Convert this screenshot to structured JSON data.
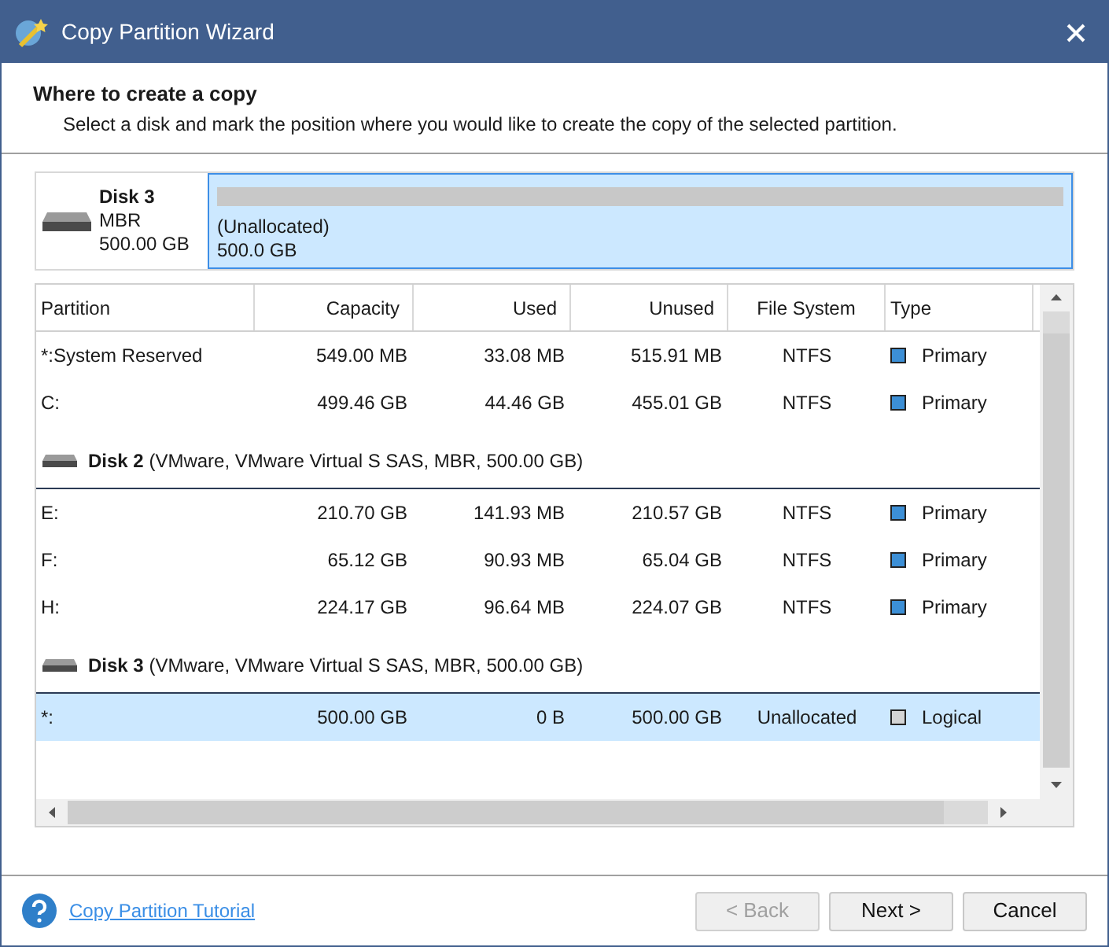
{
  "window": {
    "title": "Copy Partition Wizard"
  },
  "header": {
    "title": "Where to create a copy",
    "subtitle": "Select a disk and mark the position where you would like to create the copy of the selected partition."
  },
  "disk_map": {
    "name": "Disk 3",
    "scheme": "MBR",
    "size": "500.00 GB",
    "segments": [
      {
        "label": "(Unallocated)",
        "size": "500.0 GB",
        "selected": true
      }
    ]
  },
  "table": {
    "columns": [
      "Partition",
      "Capacity",
      "Used",
      "Unused",
      "File System",
      "Type"
    ],
    "rows": [
      {
        "kind": "partition",
        "selected": false,
        "cells": [
          "*:System Reserved",
          "549.00 MB",
          "33.08 MB",
          "515.91 MB",
          "NTFS",
          "Primary"
        ],
        "color": "#3c8fd6"
      },
      {
        "kind": "partition",
        "selected": false,
        "cells": [
          "C:",
          "499.46 GB",
          "44.46 GB",
          "455.01 GB",
          "NTFS",
          "Primary"
        ],
        "color": "#3c8fd6"
      },
      {
        "kind": "disk",
        "name": "Disk 2",
        "details": "(VMware, VMware Virtual S SAS, MBR, 500.00 GB)"
      },
      {
        "kind": "partition",
        "selected": false,
        "cells": [
          "E:",
          "210.70 GB",
          "141.93 MB",
          "210.57 GB",
          "NTFS",
          "Primary"
        ],
        "color": "#3c8fd6"
      },
      {
        "kind": "partition",
        "selected": false,
        "cells": [
          "F:",
          "65.12 GB",
          "90.93 MB",
          "65.04 GB",
          "NTFS",
          "Primary"
        ],
        "color": "#3c8fd6"
      },
      {
        "kind": "partition",
        "selected": false,
        "cells": [
          "H:",
          "224.17 GB",
          "96.64 MB",
          "224.07 GB",
          "NTFS",
          "Primary"
        ],
        "color": "#3c8fd6"
      },
      {
        "kind": "disk",
        "name": "Disk 3",
        "details": "(VMware, VMware Virtual S SAS, MBR, 500.00 GB)"
      },
      {
        "kind": "partition",
        "selected": true,
        "cells": [
          "*:",
          "500.00 GB",
          "0 B",
          "500.00 GB",
          "Unallocated",
          "Logical"
        ],
        "color": "#d4d4d4"
      }
    ]
  },
  "footer": {
    "link": "Copy Partition Tutorial",
    "buttons": [
      {
        "label": "< Back",
        "disabled": true
      },
      {
        "label": "Next >",
        "disabled": false
      },
      {
        "label": "Cancel",
        "disabled": false
      }
    ]
  }
}
